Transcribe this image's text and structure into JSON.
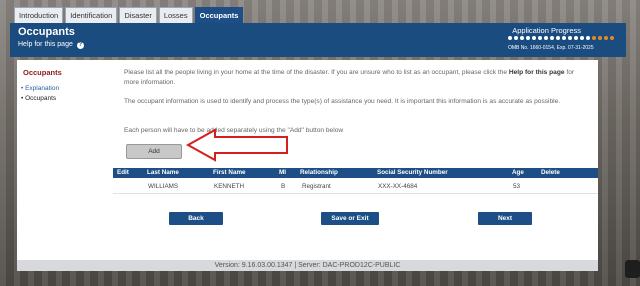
{
  "tabs": [
    "Introduction",
    "Identification",
    "Disaster",
    "Losses",
    "Occupants"
  ],
  "header": {
    "title": "Occupants",
    "help": "Help for this page",
    "help_icon": "?",
    "progress_label": "Application Progress",
    "progress_completed": 14,
    "progress_total": 18,
    "omb": "OMB No. 1660-0154, Exp. 07-31-2025"
  },
  "sidebar": {
    "title": "Occupants",
    "items": [
      "Explanation",
      "Occupants"
    ]
  },
  "main": {
    "para1_text": "Please list all the people living in your home at the time of the disaster. If you are unsure who to list as an occupant, please click the ",
    "para1_bold": "Help for this page",
    "para1_end": " for more information.",
    "para2": "The occupant information is used to identify and process the type(s) of assistance you need. It is important this information is as accurate as possible.",
    "para3": "Each person will have to be added separately using the \"Add\" button below",
    "add_button": "Add"
  },
  "table": {
    "headers": [
      "Edit",
      "Last Name",
      "First Name",
      "MI",
      "Relationship",
      "Social Security Number",
      "Age",
      "Delete"
    ],
    "rows": [
      [
        "",
        "WILLIAMS",
        "KENNETH",
        "B",
        "Registrant",
        "XXX-XX-4684",
        "53",
        ""
      ]
    ]
  },
  "buttons": {
    "back": "Back",
    "save_exit": "Save or Exit",
    "next": "Next"
  },
  "footer": "Version: 9.16.03.00.1347  |  Server: DAC-PROD12C-PUBLIC",
  "colors": {
    "header_bg": "#1a4c80",
    "accent": "#1d4f86",
    "sidebar_title": "#8b1a1a",
    "annotation_arrow": "#d41f1f"
  }
}
